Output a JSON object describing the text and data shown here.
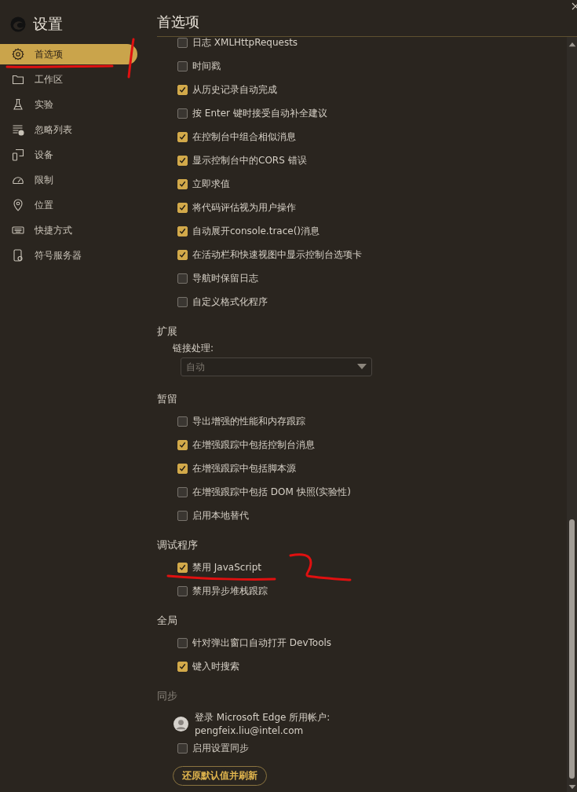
{
  "sidebar": {
    "title": "设置",
    "items": [
      {
        "label": "首选项",
        "selected": true
      },
      {
        "label": "工作区",
        "selected": false
      },
      {
        "label": "实验",
        "selected": false
      },
      {
        "label": "忽略列表",
        "selected": false
      },
      {
        "label": "设备",
        "selected": false
      },
      {
        "label": "限制",
        "selected": false
      },
      {
        "label": "位置",
        "selected": false
      },
      {
        "label": "快捷方式",
        "selected": false
      },
      {
        "label": "符号服务器",
        "selected": false
      }
    ]
  },
  "page_title": "首选项",
  "sections": [
    {
      "disabled": false,
      "rows": [
        {
          "kind": "checkbox",
          "label": "日志 XMLHttpRequests",
          "checked": false
        },
        {
          "kind": "checkbox",
          "label": "时间戳",
          "checked": false
        },
        {
          "kind": "checkbox",
          "label": "从历史记录自动完成",
          "checked": true
        },
        {
          "kind": "checkbox",
          "label": "按 Enter 键时接受自动补全建议",
          "checked": false
        },
        {
          "kind": "checkbox",
          "label": "在控制台中组合相似消息",
          "checked": true
        },
        {
          "kind": "checkbox",
          "label": "显示控制台中的CORS 错误",
          "checked": true
        },
        {
          "kind": "checkbox",
          "label": "立即求值",
          "checked": true
        },
        {
          "kind": "checkbox",
          "label": "将代码评估视为用户操作",
          "checked": true
        },
        {
          "kind": "checkbox",
          "label": "自动展开console.trace()消息",
          "checked": true
        },
        {
          "kind": "checkbox",
          "label": "在活动栏和快速视图中显示控制台选项卡",
          "checked": true
        },
        {
          "kind": "checkbox",
          "label": "导航时保留日志",
          "checked": false
        },
        {
          "kind": "checkbox",
          "label": "自定义格式化程序",
          "checked": false
        }
      ]
    },
    {
      "title": "扩展",
      "disabled": false,
      "rows": [
        {
          "kind": "select",
          "label": "链接处理:",
          "value": "自动",
          "disabled": true
        }
      ]
    },
    {
      "title": "暂留",
      "disabled": false,
      "rows": [
        {
          "kind": "checkbox",
          "label": "导出增强的性能和内存跟踪",
          "checked": false
        },
        {
          "kind": "checkbox",
          "label": "在增强跟踪中包括控制台消息",
          "checked": true
        },
        {
          "kind": "checkbox",
          "label": "在增强跟踪中包括脚本源",
          "checked": true
        },
        {
          "kind": "checkbox",
          "label": "在增强跟踪中包括 DOM 快照(实验性)",
          "checked": false
        },
        {
          "kind": "checkbox",
          "label": "启用本地替代",
          "checked": false
        }
      ]
    },
    {
      "title": "调试程序",
      "disabled": false,
      "rows": [
        {
          "kind": "checkbox",
          "label": "禁用 JavaScript",
          "checked": true
        },
        {
          "kind": "checkbox",
          "label": "禁用异步堆栈跟踪",
          "checked": false
        }
      ]
    },
    {
      "title": "全局",
      "disabled": false,
      "rows": [
        {
          "kind": "checkbox",
          "label": "针对弹出窗口自动打开 DevTools",
          "checked": false
        },
        {
          "kind": "checkbox",
          "label": "键入时搜索",
          "checked": true
        }
      ]
    },
    {
      "title": "同步",
      "disabled": true,
      "rows": [
        {
          "kind": "account",
          "label": "登录 Microsoft Edge 所用帐户:",
          "email": "pengfeix.liu@intel.com"
        },
        {
          "kind": "checkbox",
          "label": "启用设置同步",
          "checked": false
        },
        {
          "kind": "button",
          "label": "还原默认值并刷新"
        }
      ]
    }
  ]
}
